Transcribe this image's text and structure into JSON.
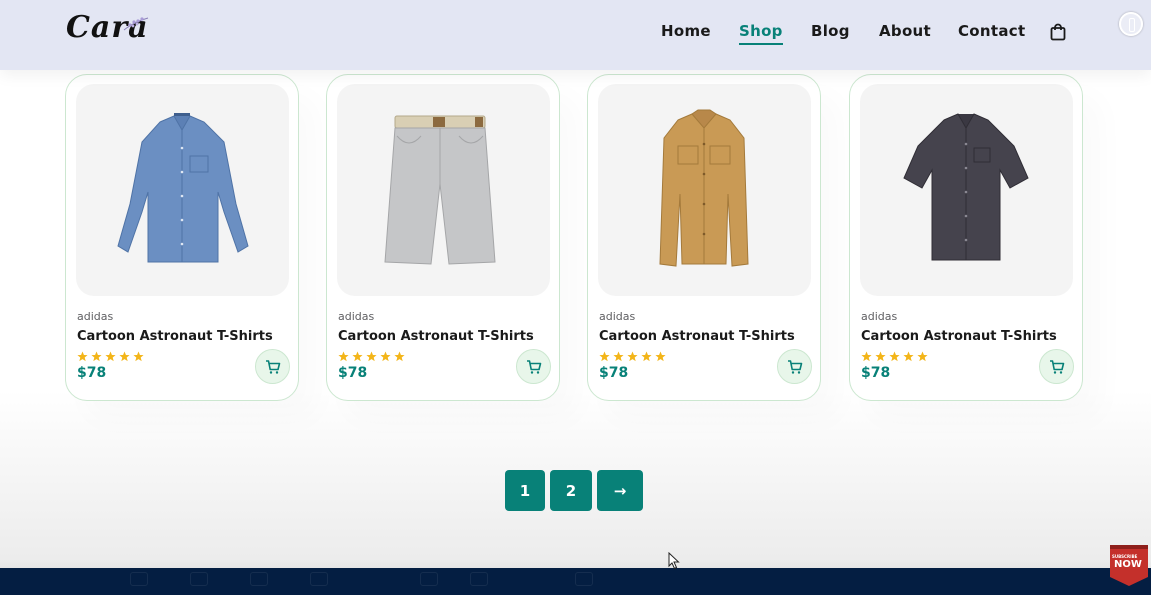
{
  "brand": {
    "logo_text": "Cara"
  },
  "nav": {
    "items": [
      {
        "label": "Home",
        "active": false
      },
      {
        "label": "Shop",
        "active": true
      },
      {
        "label": "Blog",
        "active": false
      },
      {
        "label": "About",
        "active": false
      },
      {
        "label": "Contact",
        "active": false
      }
    ],
    "cart_icon": "shopping-bag-icon"
  },
  "products": [
    {
      "brand": "adidas",
      "name": "Cartoon Astronaut T-Shirts",
      "rating": 5,
      "price": "$78",
      "image": "blue-long-sleeve-shirt"
    },
    {
      "brand": "adidas",
      "name": "Cartoon Astronaut T-Shirts",
      "rating": 5,
      "price": "$78",
      "image": "grey-shorts"
    },
    {
      "brand": "adidas",
      "name": "Cartoon Astronaut T-Shirts",
      "rating": 5,
      "price": "$78",
      "image": "tan-jacket"
    },
    {
      "brand": "adidas",
      "name": "Cartoon Astronaut T-Shirts",
      "rating": 5,
      "price": "$78",
      "image": "dark-short-sleeve-shirt"
    }
  ],
  "pagination": {
    "pages": [
      "1",
      "2"
    ],
    "next_label": "→"
  },
  "subscribe": {
    "small": "SUBSCRIBE",
    "big": "NOW"
  },
  "colors": {
    "accent": "#088178",
    "header_bg": "#e3e6f3",
    "star": "#f3b519",
    "footer": "#041e42",
    "badge": "#c4302b"
  }
}
